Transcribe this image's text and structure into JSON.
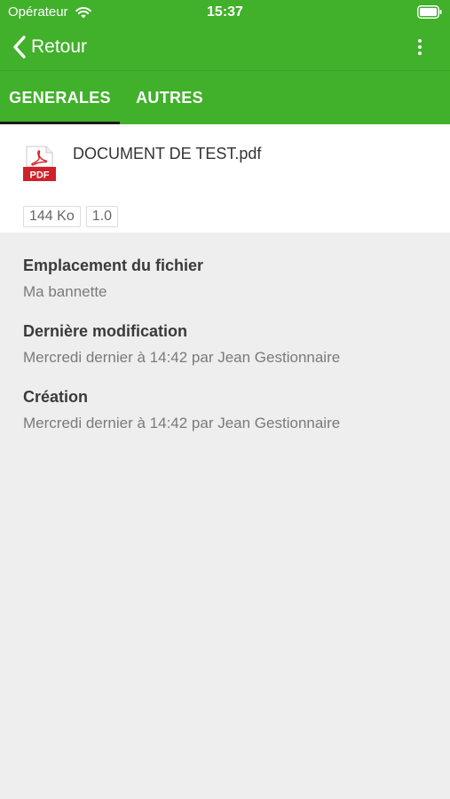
{
  "status_bar": {
    "carrier": "Opérateur",
    "time": "15:37",
    "wifi_icon": "wifi-icon",
    "battery_icon": "battery-icon"
  },
  "nav": {
    "back_label": "Retour",
    "back_icon": "chevron-left-icon",
    "more_icon": "more-vertical-icon"
  },
  "tabs": [
    {
      "label": "GENERALES",
      "active": true
    },
    {
      "label": "AUTRES",
      "active": false
    }
  ],
  "file": {
    "name": "DOCUMENT DE TEST.pdf",
    "icon": "pdf-file-icon",
    "icon_label": "PDF",
    "size": "144 Ko",
    "version": "1.0"
  },
  "details": [
    {
      "title": "Emplacement du fichier",
      "value": "Ma bannette"
    },
    {
      "title": "Dernière modification",
      "value": "Mercredi dernier à 14:42 par Jean Gestionnaire"
    },
    {
      "title": "Création",
      "value": "Mercredi dernier à 14:42 par Jean Gestionnaire"
    }
  ],
  "colors": {
    "header_green": "#41b02a",
    "background": "#eeeeee",
    "pdf_red": "#d0202a",
    "tab_indicator": "#1a1a1a"
  }
}
